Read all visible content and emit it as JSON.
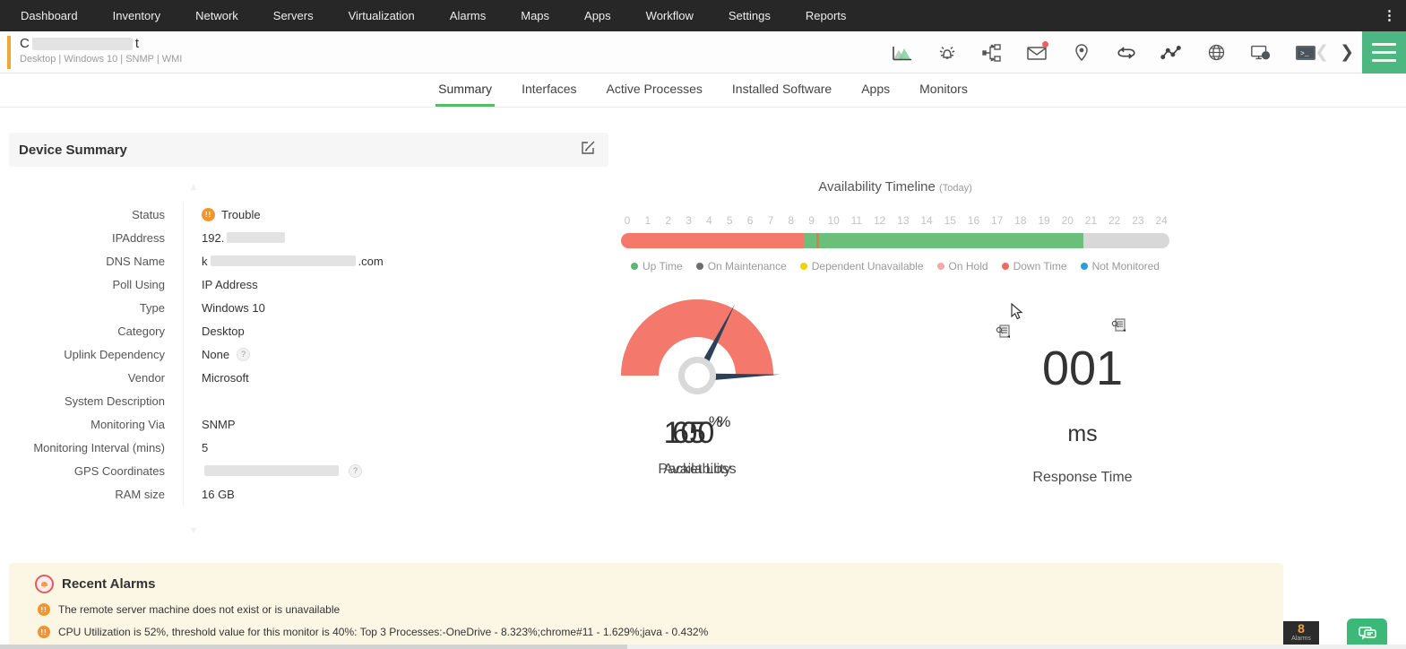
{
  "nav": {
    "items": [
      "Dashboard",
      "Inventory",
      "Network",
      "Servers",
      "Virtualization",
      "Alarms",
      "Maps",
      "Apps",
      "Workflow",
      "Settings",
      "Reports"
    ],
    "more_icon": "vertical-ellipsis"
  },
  "header": {
    "name_prefix": "C",
    "name_suffix": "t",
    "subtitle": "Desktop | Windows 10  | SNMP  | WMI",
    "toolbar_icons": [
      "performance-graph-icon",
      "alarm-bell-icon",
      "topology-icon",
      "mail-icon",
      "location-pin-icon",
      "dependency-loop-icon",
      "line-chart-icon",
      "globe-icon",
      "remote-session-icon",
      "terminal-icon"
    ],
    "accent_color": "#eda83c",
    "menu_color": "#4cb780"
  },
  "tabs": {
    "items": [
      {
        "label": "Summary",
        "cls": "active"
      },
      {
        "label": "Interfaces"
      },
      {
        "label": "Active Processes"
      },
      {
        "label": "Installed Software"
      },
      {
        "label": "Apps"
      },
      {
        "label": "Monitors"
      }
    ]
  },
  "device_summary": {
    "title": "Device Summary",
    "fields": [
      {
        "label": "Status",
        "value": "Trouble",
        "trouble": true
      },
      {
        "label": "IPAddress",
        "prefix": "192.",
        "redact": "65px"
      },
      {
        "label": "DNS Name",
        "prefix": "k",
        "redact": "162px",
        "suffix": ".com"
      },
      {
        "label": "Poll Using",
        "value": "IP Address"
      },
      {
        "label": "Type",
        "value": "Windows 10"
      },
      {
        "label": "Category",
        "value": "Desktop"
      },
      {
        "label": "Uplink Dependency",
        "value": "None",
        "help": true
      },
      {
        "label": "Vendor",
        "value": "Microsoft"
      },
      {
        "label": "System Description",
        "value": ""
      },
      {
        "label": "Monitoring Via",
        "value": "SNMP"
      },
      {
        "label": "Monitoring Interval (mins)",
        "value": "5"
      },
      {
        "label": "GPS Coordinates",
        "redact": "150px",
        "help": true
      },
      {
        "label": "RAM size",
        "value": "16 GB"
      }
    ]
  },
  "timeline": {
    "title": "Availability Timeline",
    "subtitle": "(Today)",
    "hours": [
      "0",
      "1",
      "2",
      "3",
      "4",
      "5",
      "6",
      "7",
      "8",
      "9",
      "10",
      "11",
      "12",
      "13",
      "14",
      "15",
      "16",
      "17",
      "18",
      "19",
      "20",
      "21",
      "22",
      "23",
      "24"
    ],
    "segments": [
      {
        "status": "Down Time",
        "width": "33.4%",
        "color": "#f4796c"
      },
      {
        "status": "Up Time",
        "width": "2.2%",
        "color": "#6cbf7a"
      },
      {
        "status": "Down Time",
        "width": "0.5%",
        "color": "#e07a50"
      },
      {
        "status": "Up Time",
        "width": "48.2%",
        "color": "#6cbf7a"
      },
      {
        "status": "Not Monitored",
        "width": "15.7%",
        "color": "#d8d8d8"
      }
    ],
    "legend": [
      {
        "label": "Up Time",
        "color": "#5cb870"
      },
      {
        "label": "On Maintenance",
        "color": "#6e6e6e"
      },
      {
        "label": "Dependent Unavailable",
        "color": "#f0d000"
      },
      {
        "label": "On Hold",
        "color": "#f6a9a9"
      },
      {
        "label": "Down Time",
        "color": "#ef6a5e"
      },
      {
        "label": "Not Monitored",
        "color": "#2d9cdb"
      }
    ]
  },
  "gauges": [
    {
      "value": "65",
      "unit": "%",
      "label": "Availability",
      "color": "#6abf77",
      "needle_deg": "27deg"
    },
    {
      "value": "100",
      "unit": "%",
      "label": "Packet Loss",
      "color": "#f4786b",
      "needle_deg": "88deg"
    }
  ],
  "response_time": {
    "value": "001",
    "unit": "ms",
    "label": "Response Time"
  },
  "recent_alarms": {
    "title": "Recent Alarms",
    "items": [
      {
        "text": "The remote server machine does not exist or is unavailable"
      },
      {
        "text": "CPU Utilization is 52%, threshold value for this monitor is 40%: Top 3 Processes:-OneDrive - 8.323%;chrome#11 - 1.629%;java - 0.432%"
      }
    ]
  },
  "alarm_badge": {
    "count": "8",
    "label": "Alarms"
  }
}
